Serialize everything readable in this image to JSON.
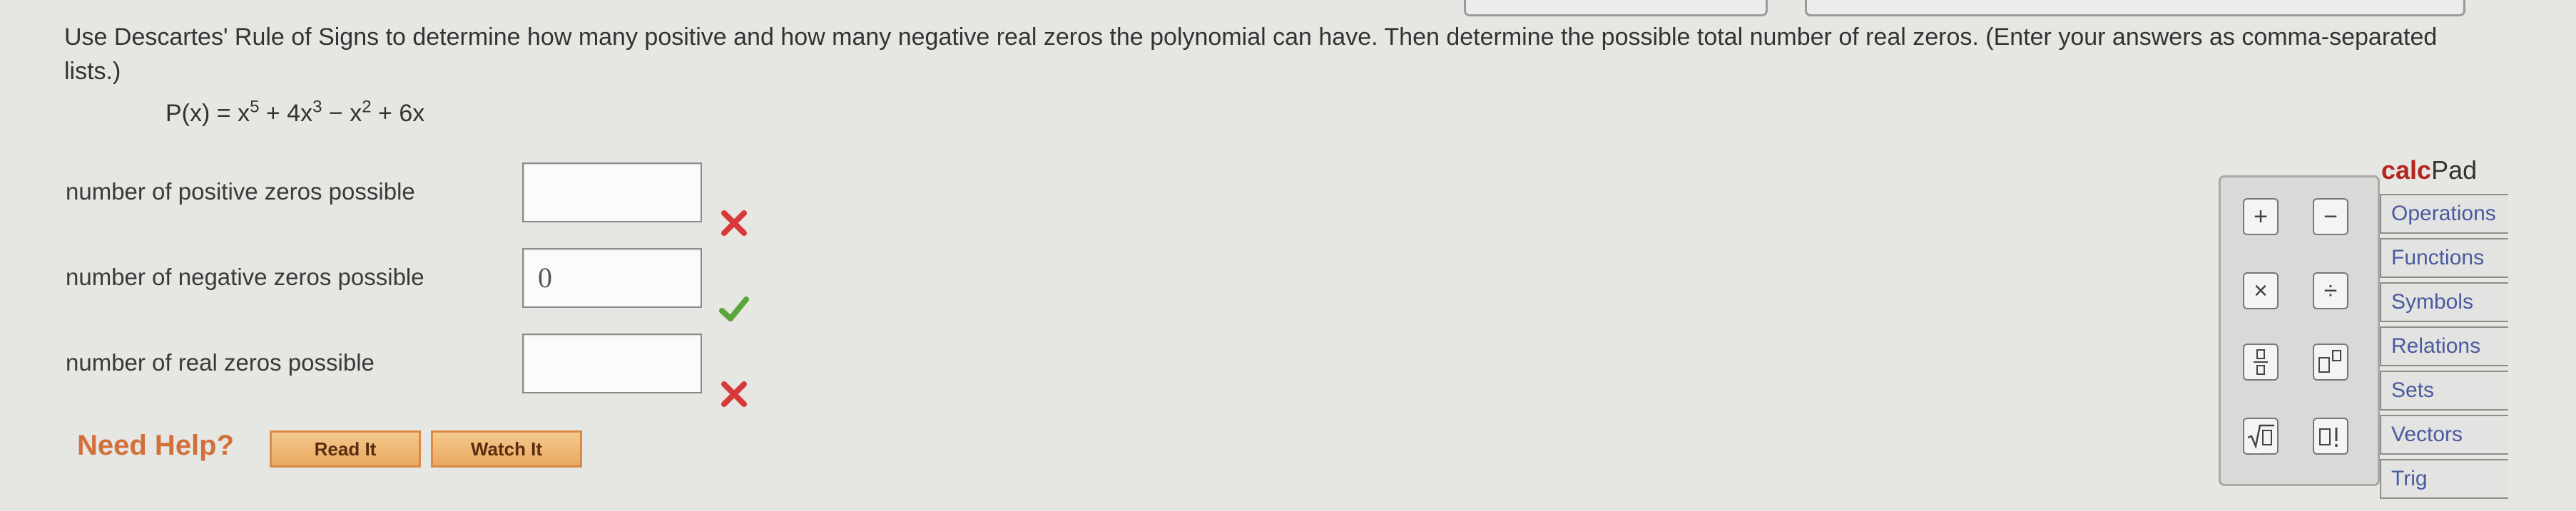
{
  "question": {
    "text": "Use Descartes' Rule of Signs to determine how many positive and how many negative real zeros the polynomial can have. Then determine the possible total number of real zeros. (Enter your answers as comma-separated lists.)"
  },
  "polynomial": {
    "lhs": "P(x) = x",
    "e1": "5",
    "t2": " + 4x",
    "e2": "3",
    "t3": " − x",
    "e3": "2",
    "t4": " + 6x"
  },
  "answers": [
    {
      "label": "number of positive zeros possible",
      "value": "",
      "status": "incorrect"
    },
    {
      "label": "number of negative zeros possible",
      "value": "0",
      "status": "correct"
    },
    {
      "label": "number of real zeros possible",
      "value": "",
      "status": "incorrect"
    }
  ],
  "help": {
    "need_help_label": "Need Help?",
    "read_it_label": "Read It",
    "watch_it_label": "Watch It"
  },
  "calcpad": {
    "title_bold": "calc",
    "title_rest": "Pad",
    "keys": [
      "+",
      "−",
      "×",
      "÷",
      "□/□",
      "□□",
      "√□",
      "□!"
    ],
    "categories": [
      "Operations",
      "Functions",
      "Symbols",
      "Relations",
      "Sets",
      "Vectors",
      "Trig"
    ]
  },
  "colors": {
    "incorrect": "#d9383a",
    "correct": "#5aa53a",
    "help_orange": "#d2703a",
    "calc_red": "#b3261e"
  }
}
